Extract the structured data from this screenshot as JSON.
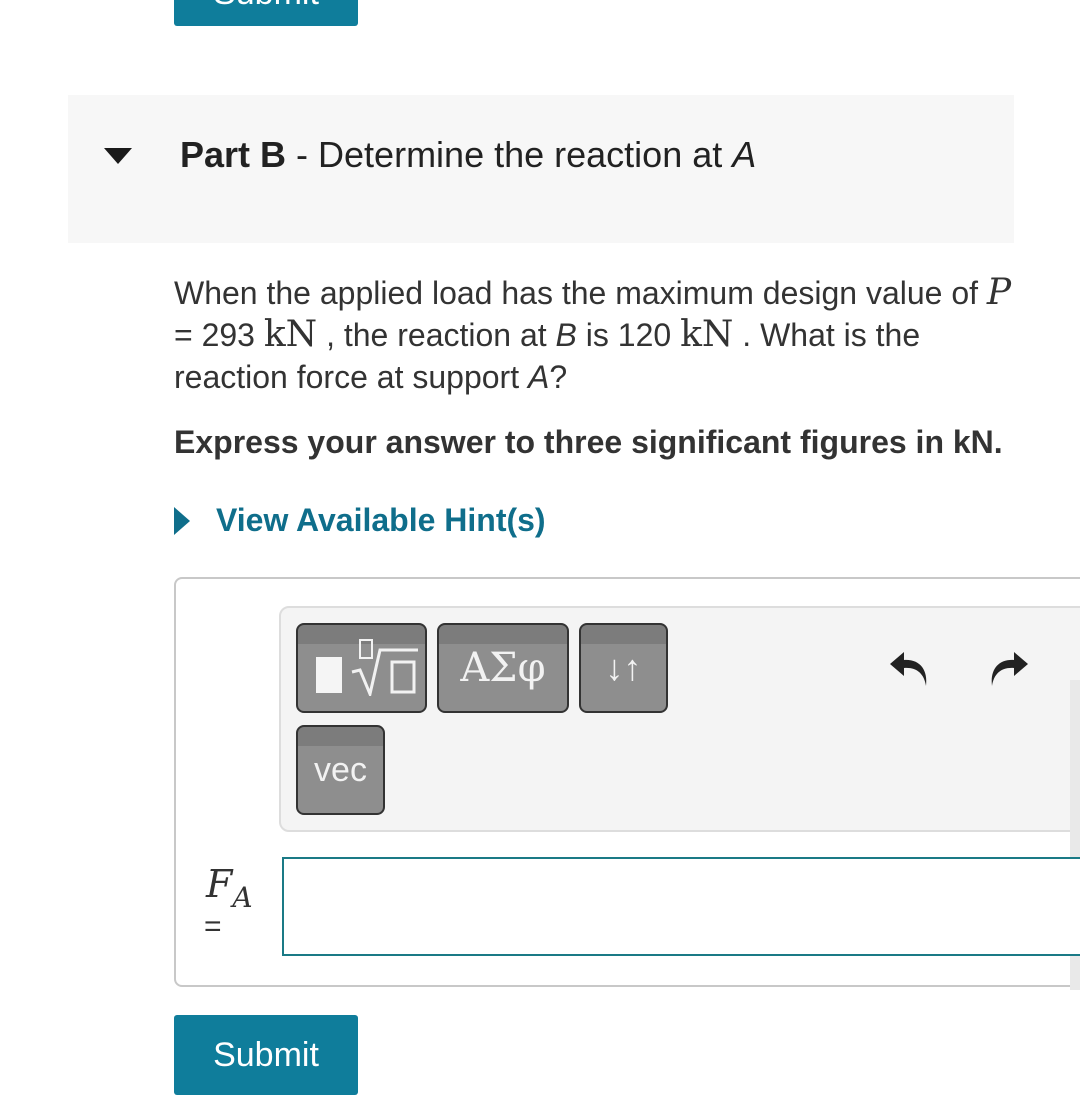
{
  "top": {
    "submit_label": "Submit"
  },
  "part": {
    "label": "Part B",
    "separator": " - ",
    "title_prefix": "Determine the reaction at ",
    "title_var": "A"
  },
  "question": {
    "text1": "When the applied load has the maximum design value of ",
    "p_var": "P",
    "eq1": " = 293 ",
    "unit1": "kN",
    "text2": " , the reaction at ",
    "b_var": "B",
    "text3": " is 120 ",
    "unit2": "kN",
    "text4": " . What is the reaction force at support ",
    "a_var": "A",
    "text5": "?"
  },
  "instruction": "Express your answer to three significant figures in kN.",
  "hint": {
    "label": "View Available Hint(s)"
  },
  "toolbar": {
    "greek_label": "ΑΣφ",
    "arrows_label": "↓↑",
    "vec_label": "vec",
    "icons": [
      "templates-icon",
      "undo-icon",
      "redo-icon"
    ]
  },
  "answer": {
    "var": "F",
    "sub": "A",
    "eq": "=",
    "value": ""
  },
  "submit": {
    "label": "Submit"
  },
  "colors": {
    "accent": "#0f7d9b",
    "link": "#0f6e8b",
    "input_border": "#1a7a86"
  }
}
